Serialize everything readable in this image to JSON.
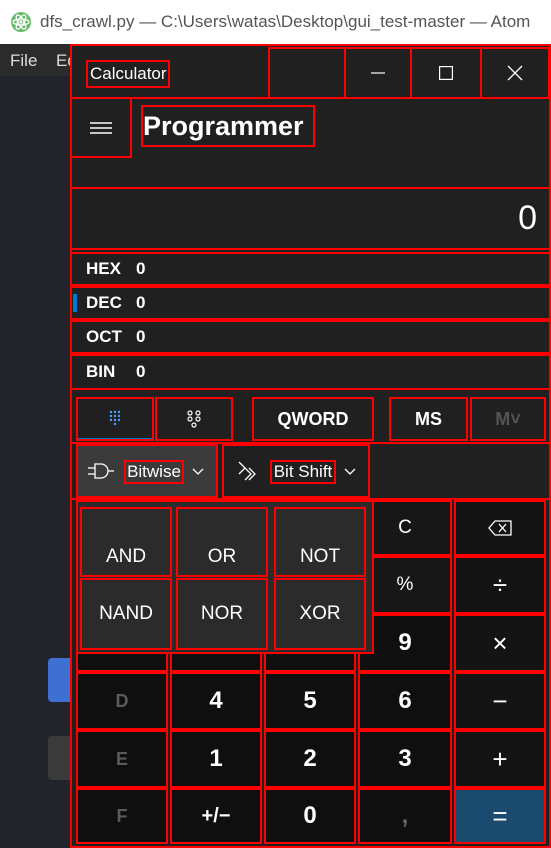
{
  "atom": {
    "title": "dfs_crawl.py — C:\\Users\\watas\\Desktop\\gui_test-master — Atom",
    "menu": [
      "File",
      "Ed"
    ]
  },
  "calculator": {
    "title": "Calculator",
    "mode": "Programmer",
    "display": "0",
    "radix": [
      {
        "name": "HEX",
        "value": "0"
      },
      {
        "name": "DEC",
        "value": "0"
      },
      {
        "name": "OCT",
        "value": "0"
      },
      {
        "name": "BIN",
        "value": "0"
      }
    ],
    "word_size": "QWORD",
    "memory_store": "MS",
    "memory_recall": "M˅",
    "bitwise_label": "Bitwise",
    "bitshift_label": "Bit Shift",
    "bitwise_ops": [
      "AND",
      "OR",
      "NOT",
      "NAND",
      "NOR",
      "XOR"
    ],
    "keys": {
      "clear": "C",
      "percent": "%",
      "nine": "9",
      "d": "D",
      "four": "4",
      "five": "5",
      "six": "6",
      "e": "E",
      "one": "1",
      "two": "2",
      "three": "3",
      "f": "F",
      "negate": "+/−",
      "zero": "0",
      "decimal": ",",
      "minus": "−",
      "plus": "+",
      "equals": "=",
      "divide": "÷",
      "multiply": "×"
    },
    "colors": {
      "accent": "#0078d4",
      "equals_bg": "#1a4a6e"
    }
  }
}
